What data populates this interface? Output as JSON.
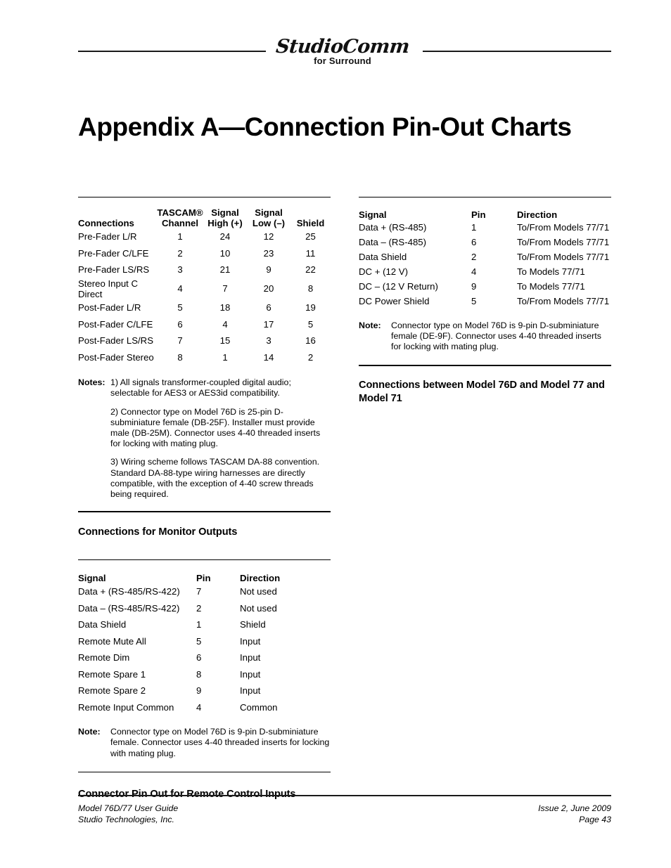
{
  "header": {
    "logo_script": "StudioComm",
    "logo_sub": "for Surround"
  },
  "title": "Appendix A—Connection Pin-Out Charts",
  "left_column": {
    "tascam_table": {
      "headers": {
        "connections": "Connections",
        "channel_line1": "TASCAM®",
        "channel_line2": "Channel",
        "high_line1": "Signal",
        "high_line2": "High (+)",
        "low_line1": "Signal",
        "low_line2": "Low (–)",
        "shield": "Shield"
      },
      "rows": [
        {
          "connection": "Pre-Fader L/R",
          "channel": "1",
          "high": "24",
          "low": "12",
          "shield": "25"
        },
        {
          "connection": "Pre-Fader C/LFE",
          "channel": "2",
          "high": "10",
          "low": "23",
          "shield": "11"
        },
        {
          "connection": "Pre-Fader LS/RS",
          "channel": "3",
          "high": "21",
          "low": "9",
          "shield": "22"
        },
        {
          "connection": "Stereo Input C Direct",
          "channel": "4",
          "high": "7",
          "low": "20",
          "shield": "8"
        },
        {
          "connection": "Post-Fader L/R",
          "channel": "5",
          "high": "18",
          "low": "6",
          "shield": "19"
        },
        {
          "connection": "Post-Fader C/LFE",
          "channel": "6",
          "high": "4",
          "low": "17",
          "shield": "5"
        },
        {
          "connection": "Post-Fader LS/RS",
          "channel": "7",
          "high": "15",
          "low": "3",
          "shield": "16"
        },
        {
          "connection": "Post-Fader Stereo",
          "channel": "8",
          "high": "1",
          "low": "14",
          "shield": "2"
        }
      ]
    },
    "notes_block": {
      "label": "Notes:",
      "paragraphs": [
        "1) All signals transformer-coupled digital audio; selectable for AES3 or AES3id compatibility.",
        "2) Connector type on Model 76D is 25-pin D-subminiature female (DB-25F). Installer must provide male (DB-25M). Connector uses 4-40 threaded inserts for locking with mating plug.",
        "3) Wiring scheme follows TASCAM DA-88 convention. Standard DA-88-type wiring harnesses are directly compatible, with the exception of 4-40 screw threads being required."
      ]
    },
    "section_heading_monitor": "Connections for Monitor Outputs",
    "remote_table": {
      "headers": {
        "signal": "Signal",
        "pin": "Pin",
        "direction": "Direction"
      },
      "rows": [
        {
          "signal": "Data + (RS-485/RS-422)",
          "pin": "7",
          "direction": "Not used"
        },
        {
          "signal": "Data – (RS-485/RS-422)",
          "pin": "2",
          "direction": "Not used"
        },
        {
          "signal": "Data Shield",
          "pin": "1",
          "direction": "Shield"
        },
        {
          "signal": "Remote Mute All",
          "pin": "5",
          "direction": "Input"
        },
        {
          "signal": "Remote Dim",
          "pin": "6",
          "direction": "Input"
        },
        {
          "signal": "Remote Spare 1",
          "pin": "8",
          "direction": "Input"
        },
        {
          "signal": "Remote Spare 2",
          "pin": "9",
          "direction": "Input"
        },
        {
          "signal": "Remote Input Common",
          "pin": "4",
          "direction": "Common"
        }
      ]
    },
    "note_block": {
      "label": "Note:",
      "text": "Connector type on Model 76D is 9-pin D-subminiature female. Connector uses 4-40 threaded inserts for locking with mating plug."
    },
    "section_heading_remote": "Connector Pin Out for Remote Control Inputs"
  },
  "right_column": {
    "data_table": {
      "headers": {
        "signal": "Signal",
        "pin": "Pin",
        "direction": "Direction"
      },
      "rows": [
        {
          "signal": "Data + (RS-485)",
          "pin": "1",
          "direction": "To/From Models 77/71"
        },
        {
          "signal": "Data – (RS-485)",
          "pin": "6",
          "direction": "To/From Models 77/71"
        },
        {
          "signal": "Data Shield",
          "pin": "2",
          "direction": "To/From Models 77/71"
        },
        {
          "signal": "DC + (12 V)",
          "pin": "4",
          "direction": "To Models 77/71"
        },
        {
          "signal": "DC – (12 V Return)",
          "pin": "9",
          "direction": "To Models 77/71"
        },
        {
          "signal": "DC Power Shield",
          "pin": "5",
          "direction": "To/From Models 77/71"
        }
      ]
    },
    "note_block": {
      "label": "Note:",
      "text": "Connector type on Model 76D is 9-pin D-subminiature female (DE-9F). Connector uses 4-40 threaded inserts for locking with mating plug."
    },
    "section_heading": "Connections between Model 76D and Model 77 and Model 71"
  },
  "footer": {
    "left_line1": "Model 76D/77 User Guide",
    "left_line2": "Studio Technologies, Inc.",
    "right_line1": "Issue 2, June 2009",
    "right_line2": "Page 43"
  }
}
